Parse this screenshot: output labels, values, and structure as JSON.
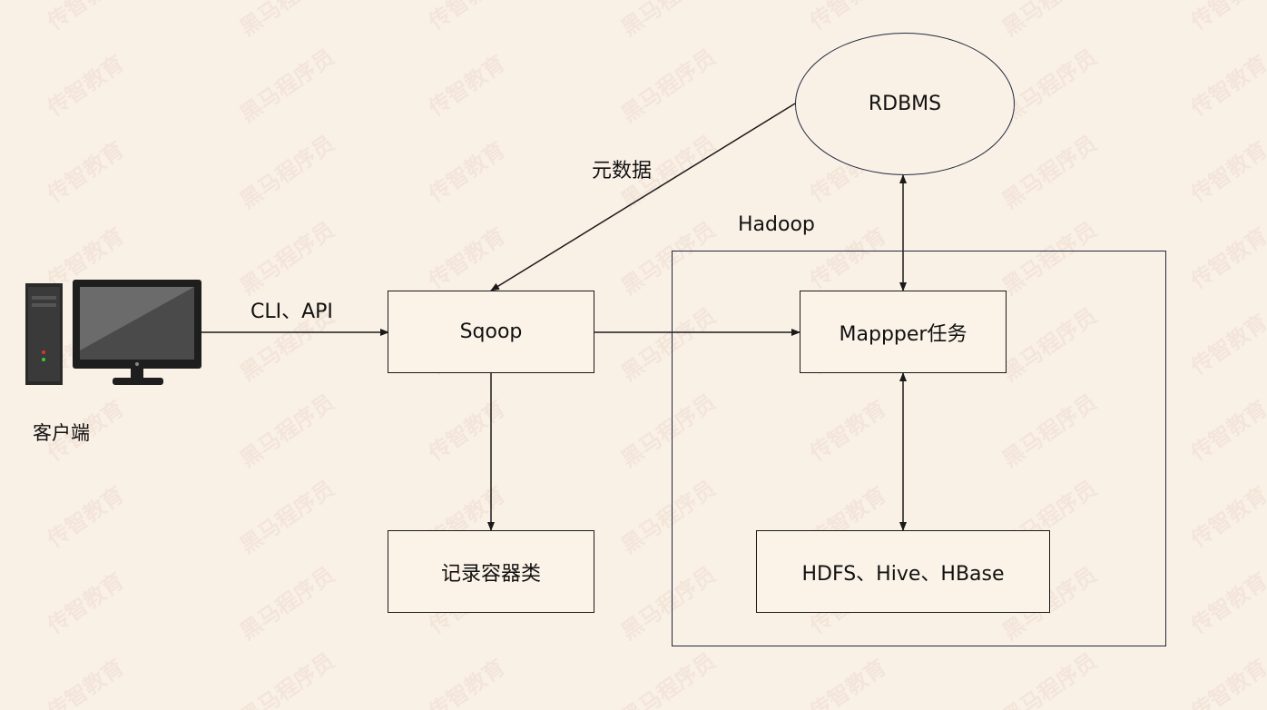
{
  "watermark": {
    "text_a": "传智教育",
    "text_b": "黑马程序员"
  },
  "client": {
    "label": "客户端",
    "icon": "desktop-computer-icon"
  },
  "edges": {
    "client_to_sqoop": "CLI、API",
    "rdbms_to_sqoop": "元数据"
  },
  "nodes": {
    "sqoop": "Sqoop",
    "record_container": "记录容器类",
    "rdbms": "RDBMS",
    "mapper": "Mappper任务",
    "storage": "HDFS、Hive、HBase"
  },
  "hadoop_group": {
    "label": "Hadoop"
  },
  "colors": {
    "background": "#faf1e6",
    "line": "#1a1a1a",
    "frame": "#1f2940"
  }
}
